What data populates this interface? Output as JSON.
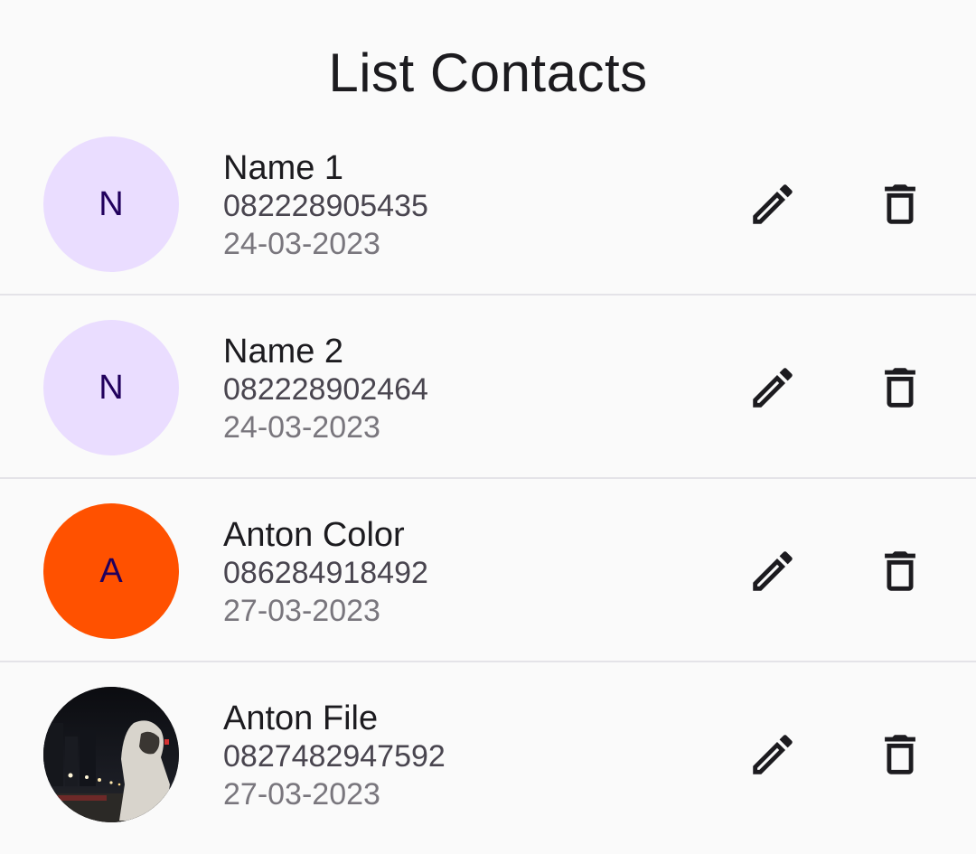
{
  "header": {
    "title": "List Contacts"
  },
  "colors": {
    "avatar_default": "#eaddff",
    "avatar_orange": "#ff5100",
    "initial_text": "#21005d",
    "icon": "#1c1b1f"
  },
  "contacts": [
    {
      "initial": "N",
      "name": "Name 1",
      "phone": "082228905435",
      "date": "24-03-2023",
      "avatar_type": "initial",
      "avatar_color": "#eaddff"
    },
    {
      "initial": "N",
      "name": "Name 2",
      "phone": "082228902464",
      "date": "24-03-2023",
      "avatar_type": "initial",
      "avatar_color": "#eaddff"
    },
    {
      "initial": "A",
      "name": "Anton Color",
      "phone": "086284918492",
      "date": "27-03-2023",
      "avatar_type": "initial",
      "avatar_color": "#ff5100"
    },
    {
      "initial": "",
      "name": "Anton File",
      "phone": "0827482947592",
      "date": "27-03-2023",
      "avatar_type": "photo",
      "avatar_color": "#1a1a1a"
    }
  ],
  "icons": {
    "edit": "pencil-icon",
    "delete": "trash-icon"
  }
}
